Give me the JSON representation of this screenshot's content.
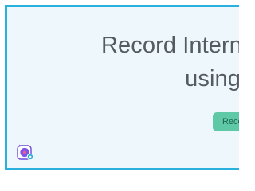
{
  "banner": {
    "title_line1": "Record Intern",
    "title_line2": "using",
    "cta_label": "Reco",
    "icon": "app-logo-icon",
    "colors": {
      "border": "#2ab0dd",
      "background": "#eef8fc",
      "title_text": "#555b63",
      "button_bg": "#5ec8a7",
      "button_text": "#1f6650"
    }
  }
}
